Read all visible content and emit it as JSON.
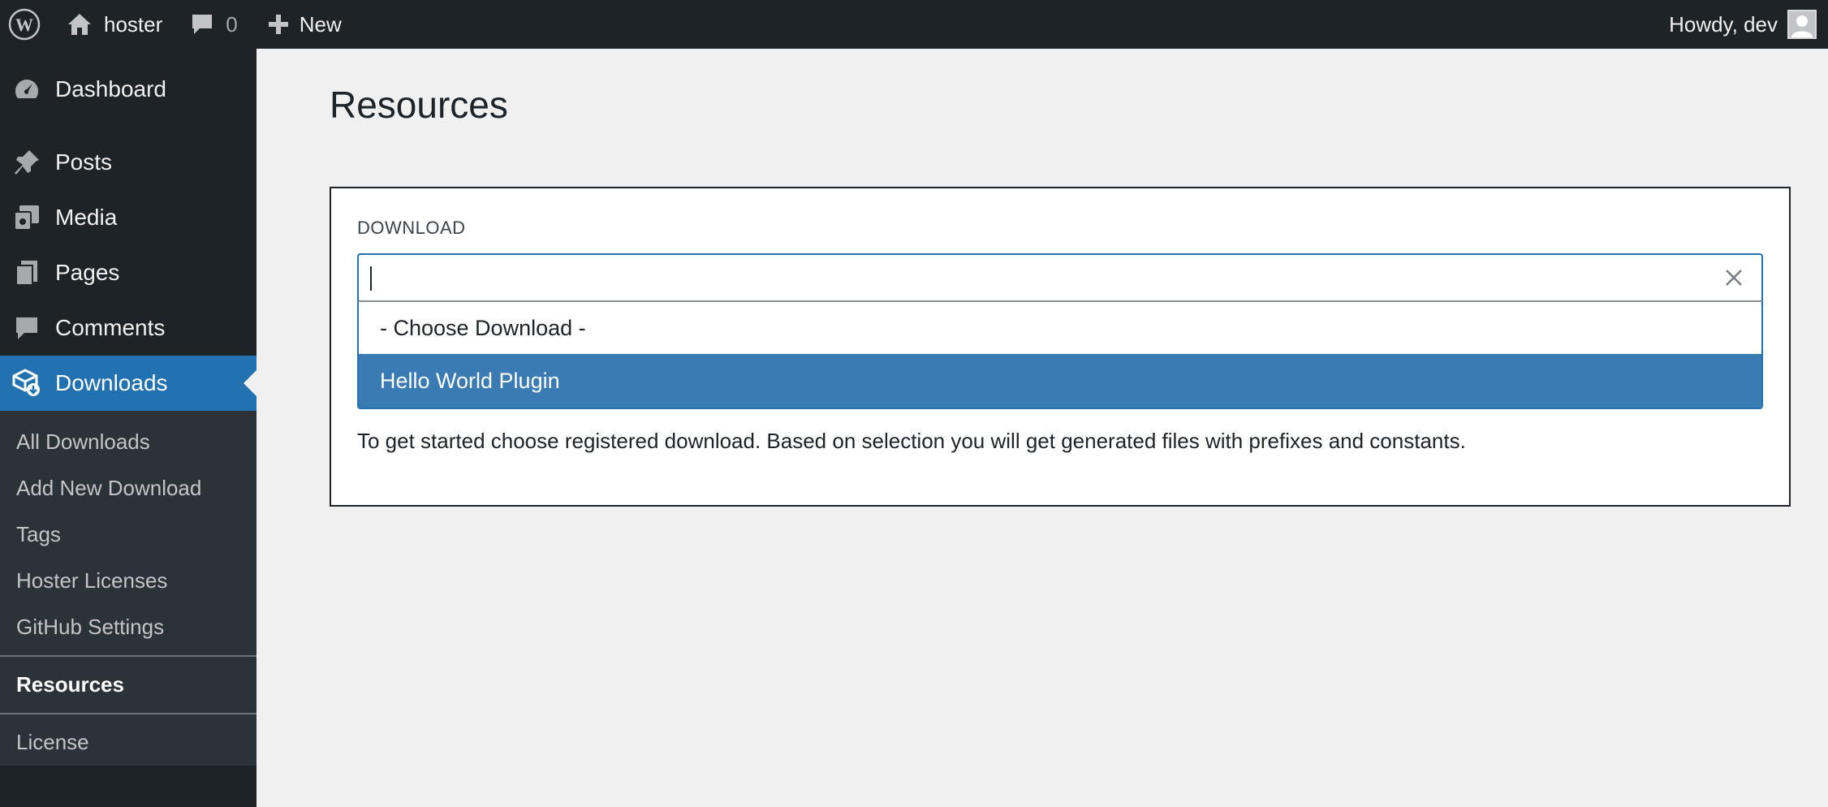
{
  "adminbar": {
    "site_name": "hoster",
    "comments_count": "0",
    "new_label": "New",
    "howdy": "Howdy, dev"
  },
  "sidebar": {
    "items": [
      {
        "label": "Dashboard",
        "icon": "dashboard-icon"
      },
      {
        "label": "Posts",
        "icon": "pin-icon"
      },
      {
        "label": "Media",
        "icon": "media-icon"
      },
      {
        "label": "Pages",
        "icon": "pages-icon"
      },
      {
        "label": "Comments",
        "icon": "comment-icon"
      },
      {
        "label": "Downloads",
        "icon": "downloads-icon"
      }
    ],
    "submenu": [
      {
        "label": "All Downloads"
      },
      {
        "label": "Add New Download"
      },
      {
        "label": "Tags"
      },
      {
        "label": "Hoster Licenses"
      },
      {
        "label": "GitHub Settings"
      },
      {
        "label": "Resources"
      },
      {
        "label": "License"
      }
    ]
  },
  "main": {
    "title": "Resources",
    "field_label": "DOWNLOAD",
    "select": {
      "value": "",
      "options": [
        "- Choose Download -",
        "Hello World Plugin"
      ],
      "highlighted": "Hello World Plugin"
    },
    "help_text": "To get started choose registered download. Based on selection you will get generated files with prefixes and constants."
  },
  "colors": {
    "admin_dark": "#1d2327",
    "submenu_bg": "#2c3338",
    "accent": "#2271b1",
    "highlight": "#3a7bb4",
    "content_bg": "#f0f0f1"
  }
}
